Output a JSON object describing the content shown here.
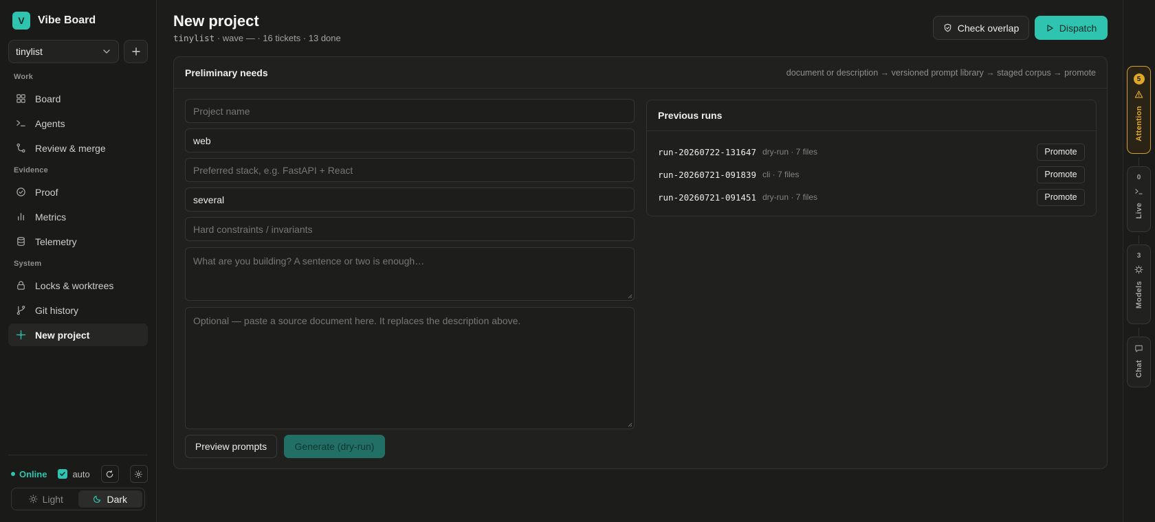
{
  "brand": {
    "logo_letter": "V",
    "name": "Vibe Board"
  },
  "project_selector": {
    "value": "tinylist"
  },
  "nav": {
    "sections": [
      {
        "label": "Work",
        "items": [
          {
            "label": "Board",
            "icon": "grid-icon"
          },
          {
            "label": "Agents",
            "icon": "terminal-icon"
          },
          {
            "label": "Review & merge",
            "icon": "merge-icon"
          }
        ]
      },
      {
        "label": "Evidence",
        "items": [
          {
            "label": "Proof",
            "icon": "check-circle-icon"
          },
          {
            "label": "Metrics",
            "icon": "bar-chart-icon"
          },
          {
            "label": "Telemetry",
            "icon": "database-icon"
          }
        ]
      },
      {
        "label": "System",
        "items": [
          {
            "label": "Locks & worktrees",
            "icon": "lock-icon"
          },
          {
            "label": "Git history",
            "icon": "git-branch-icon"
          },
          {
            "label": "New project",
            "icon": "sparkle-icon",
            "active": true
          }
        ]
      }
    ]
  },
  "status": {
    "online_label": "Online",
    "auto_label": "auto",
    "auto_checked": true
  },
  "theme": {
    "light_label": "Light",
    "dark_label": "Dark",
    "selected": "Dark"
  },
  "header": {
    "title": "New project",
    "subtitle_mono": "tinylist",
    "subtitle_rest": " · wave — · 16 tickets · 13 done",
    "check_overlap_label": "Check overlap",
    "dispatch_label": "Dispatch"
  },
  "form": {
    "title": "Preliminary needs",
    "flow": "document or description → versioned prompt library → staged corpus → promote",
    "project_name_placeholder": "Project name",
    "platform_value": "web",
    "stack_placeholder": "Preferred stack, e.g. FastAPI + React",
    "scale_value": "several",
    "constraints_placeholder": "Hard constraints / invariants",
    "description_placeholder": "What are you building? A sentence or two is enough…",
    "document_placeholder": "Optional — paste a source document here. It replaces the description above.",
    "preview_label": "Preview prompts",
    "generate_label": "Generate (dry-run)"
  },
  "previous_runs": {
    "title": "Previous runs",
    "promote_label": "Promote",
    "rows": [
      {
        "id": "run-20260722-131647",
        "meta": "dry-run · 7 files"
      },
      {
        "id": "run-20260721-091839",
        "meta": "cli · 7 files"
      },
      {
        "id": "run-20260721-091451",
        "meta": "dry-run · 7 files"
      }
    ]
  },
  "rail": {
    "attention": {
      "count": "5",
      "label": "Attention",
      "color": "#e0a923"
    },
    "live": {
      "count": "0",
      "label": "Live"
    },
    "models": {
      "count": "3",
      "label": "Models"
    },
    "chat": {
      "label": "Chat"
    }
  },
  "colors": {
    "accent": "#2ec4b0",
    "background": "#1c1c1b",
    "warning": "#e0a923"
  }
}
